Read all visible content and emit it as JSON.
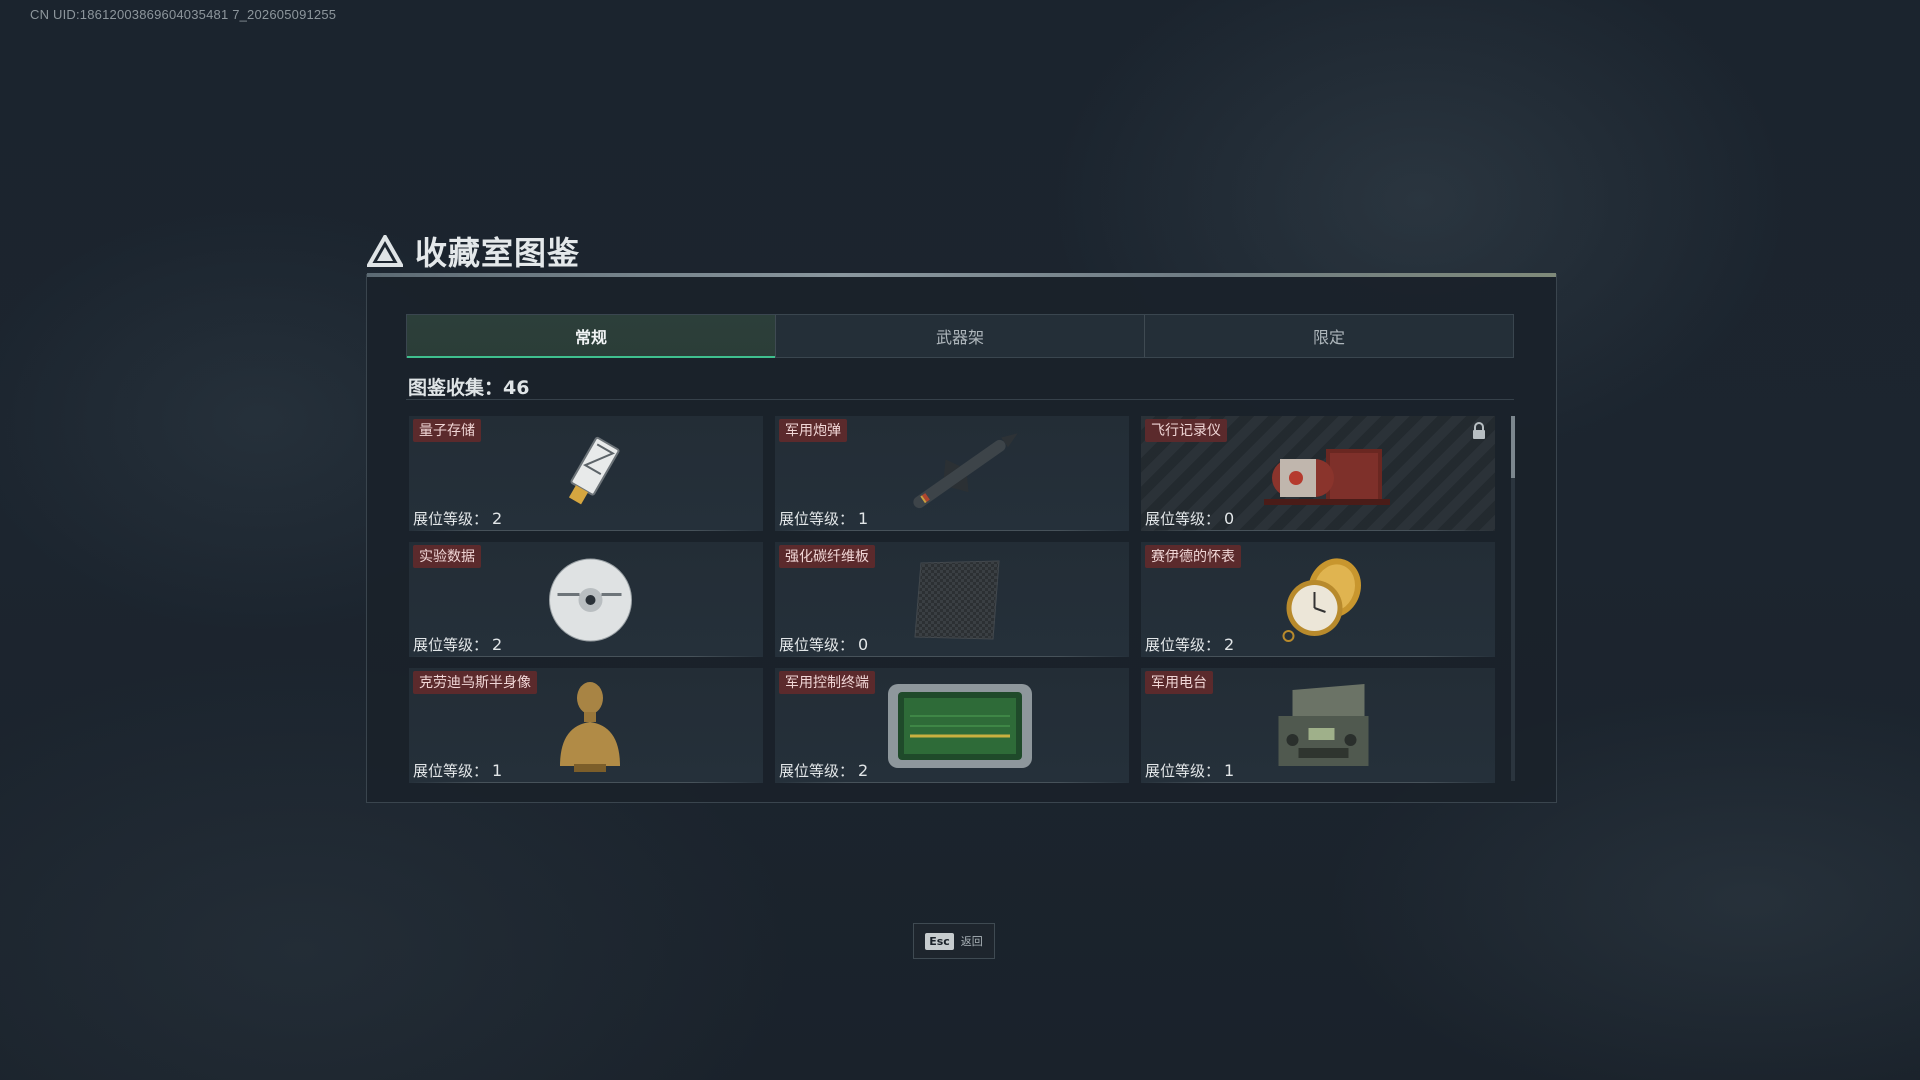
{
  "uid_text": "CN UID:18612003869604035481 7_202605091255",
  "header": {
    "title": "收藏室图鉴",
    "logo_icon": "delta-triangle-icon"
  },
  "tabs": [
    {
      "label": "常规",
      "active": true
    },
    {
      "label": "武器架",
      "active": false
    },
    {
      "label": "限定",
      "active": false
    }
  ],
  "collection": {
    "label": "图鉴收集：",
    "count": "46"
  },
  "level_label": "展位等级：",
  "items": [
    {
      "name": "量子存储",
      "level": "2",
      "icon": "usb-drive-icon",
      "locked": false
    },
    {
      "name": "军用炮弹",
      "level": "1",
      "icon": "missile-icon",
      "locked": false
    },
    {
      "name": "飞行记录仪",
      "level": "0",
      "icon": "flight-recorder-icon",
      "locked": true
    },
    {
      "name": "实验数据",
      "level": "2",
      "icon": "disc-icon",
      "locked": false
    },
    {
      "name": "强化碳纤维板",
      "level": "0",
      "icon": "carbon-plate-icon",
      "locked": false
    },
    {
      "name": "赛伊德的怀表",
      "level": "2",
      "icon": "pocket-watch-icon",
      "locked": false
    },
    {
      "name": "克劳迪乌斯半身像",
      "level": "1",
      "icon": "bust-statue-icon",
      "locked": false
    },
    {
      "name": "军用控制终端",
      "level": "2",
      "icon": "control-terminal-icon",
      "locked": false
    },
    {
      "name": "军用电台",
      "level": "1",
      "icon": "radio-icon",
      "locked": false
    }
  ],
  "footer": {
    "key": "Esc",
    "label": "返回"
  },
  "colors": {
    "accent": "#3fbf8e",
    "badge_bg": "#5b2a2c"
  }
}
